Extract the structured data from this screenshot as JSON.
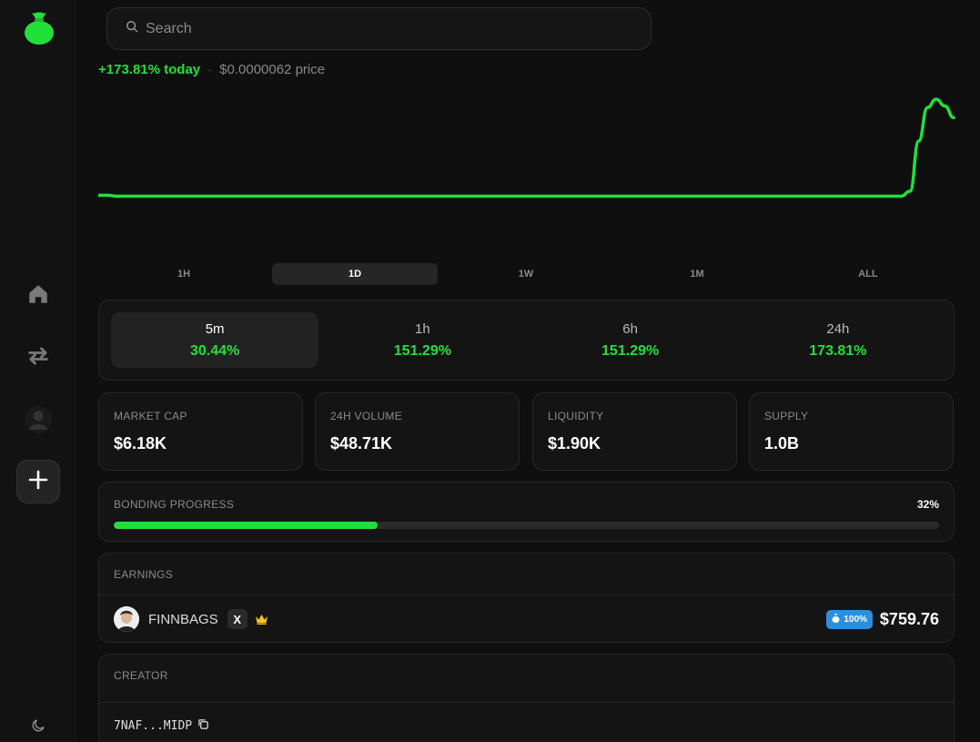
{
  "search": {
    "placeholder": "Search"
  },
  "price_row": {
    "change": "+173.81% today",
    "separator": "·",
    "price": "$0.0000062 price"
  },
  "chart_data": {
    "type": "line",
    "series": [
      {
        "values": [
          0.55,
          0.55,
          0.54,
          0.54,
          0.54,
          0.54,
          0.54,
          0.54,
          0.54,
          0.54,
          0.54,
          0.54,
          0.54,
          0.54,
          0.54,
          0.54,
          0.54,
          0.54,
          0.54,
          0.54,
          0.54,
          0.54,
          0.54,
          0.54,
          0.54,
          0.54,
          0.54,
          0.54,
          0.54,
          0.54,
          0.54,
          0.54,
          0.54,
          0.54,
          0.54,
          0.54,
          0.54,
          0.54,
          0.54,
          0.54,
          0.54,
          0.54,
          0.54,
          0.54,
          0.54,
          0.54,
          0.54,
          0.54,
          0.54,
          0.54,
          0.54,
          0.54,
          0.54,
          0.54,
          0.54,
          0.54,
          0.54,
          0.54,
          0.54,
          0.54,
          0.54,
          0.54,
          0.54,
          0.54,
          0.54,
          0.54,
          0.54,
          0.54,
          0.54,
          0.54,
          0.54,
          0.54,
          0.54,
          0.54,
          0.54,
          0.54,
          0.54,
          0.54,
          0.54,
          0.54,
          0.54,
          0.54,
          0.54,
          0.54,
          0.54,
          0.54,
          0.54,
          0.54,
          0.54,
          0.54,
          0.54,
          0.54,
          0.54,
          0.6,
          1.2,
          1.6,
          1.7,
          1.62,
          1.48
        ]
      }
    ],
    "color": "#22e03a",
    "grid": false
  },
  "time_tabs": [
    "1H",
    "1D",
    "1W",
    "1M",
    "ALL"
  ],
  "active_time_tab": "1D",
  "periods": [
    {
      "label": "5m",
      "value": "30.44%"
    },
    {
      "label": "1h",
      "value": "151.29%"
    },
    {
      "label": "6h",
      "value": "151.29%"
    },
    {
      "label": "24h",
      "value": "173.81%"
    }
  ],
  "metrics": [
    {
      "label": "MARKET CAP",
      "value": "$6.18K"
    },
    {
      "label": "24H VOLUME",
      "value": "$48.71K"
    },
    {
      "label": "LIQUIDITY",
      "value": "$1.90K"
    },
    {
      "label": "SUPPLY",
      "value": "1.0B"
    }
  ],
  "bonding": {
    "label": "BONDING PROGRESS",
    "percent_text": "32%",
    "progress": 0.32
  },
  "earnings": {
    "label": "EARNINGS",
    "name": "FINNBAGS",
    "x_label": "X",
    "share": "100%",
    "amount": "$759.76"
  },
  "creator": {
    "label": "CREATOR",
    "address": "7NAF...MIDP"
  },
  "colors": {
    "accent": "#22e03a",
    "share_badge": "#2b8fe0",
    "crown": "#f5c518"
  },
  "icons": [
    "money-bag-icon",
    "home-icon",
    "swap-icon",
    "profile-icon",
    "plus-icon",
    "moon-icon",
    "search-icon",
    "x-icon",
    "crown-icon",
    "bag-icon",
    "copy-icon"
  ]
}
